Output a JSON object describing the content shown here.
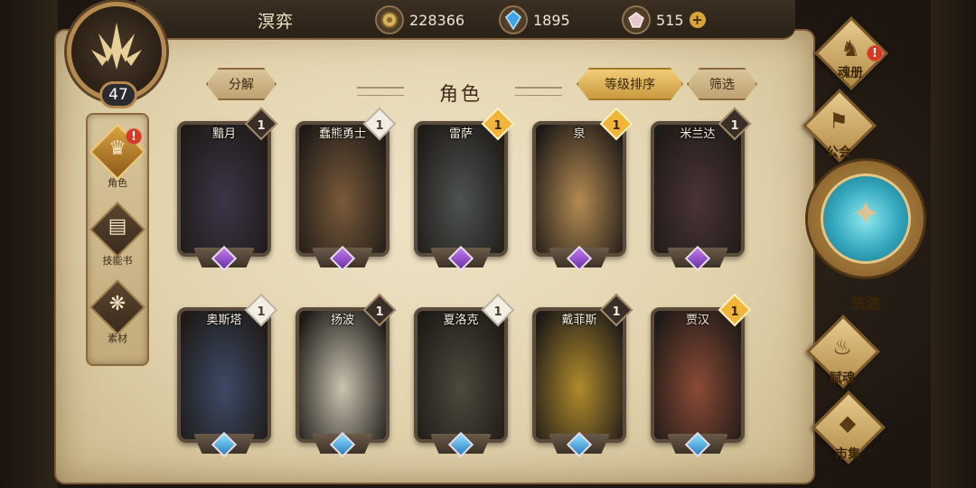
{
  "player": {
    "name": "溟弈",
    "level": "47"
  },
  "resources": [
    {
      "icon": "gold-coin-icon",
      "value": "228366"
    },
    {
      "icon": "blue-crystal-icon",
      "value": "1895"
    },
    {
      "icon": "pink-gem-icon",
      "value": "515",
      "add": "+"
    }
  ],
  "sidenav": [
    {
      "label": "角色",
      "icon": "character-icon",
      "active": true,
      "alert": "!"
    },
    {
      "label": "技能书",
      "icon": "skill-book-icon"
    },
    {
      "label": "素材",
      "icon": "material-icon"
    }
  ],
  "header": {
    "title": "角色",
    "decompose": "分解",
    "sort": "等级排序",
    "filter": "筛选"
  },
  "cards": [
    {
      "name": "黯月",
      "count": "1",
      "tag": "dark",
      "gem": "purple"
    },
    {
      "name": "蠢熊勇士",
      "count": "1",
      "tag": "white",
      "gem": "purple"
    },
    {
      "name": "雷萨",
      "count": "1",
      "tag": "gold",
      "gem": "purple"
    },
    {
      "name": "泉",
      "count": "1",
      "tag": "gold",
      "gem": "purple"
    },
    {
      "name": "米兰达",
      "count": "1",
      "tag": "dark",
      "gem": "purple"
    },
    {
      "name": "奥斯塔",
      "count": "1",
      "tag": "white",
      "gem": "blue"
    },
    {
      "name": "扬波",
      "count": "1",
      "tag": "dark",
      "gem": "blue"
    },
    {
      "name": "夏洛克",
      "count": "1",
      "tag": "white",
      "gem": "blue"
    },
    {
      "name": "戴菲斯",
      "count": "1",
      "tag": "dark",
      "gem": "blue"
    },
    {
      "name": "贾汉",
      "count": "1",
      "tag": "gold",
      "gem": "blue"
    }
  ],
  "rightmenu": {
    "soulbook": {
      "label": "魂册",
      "alert": "!"
    },
    "guild": {
      "label": "公会"
    },
    "journey": {
      "label": "旅途"
    },
    "endow": {
      "label": "赋魂"
    },
    "market": {
      "label": "市集"
    }
  }
}
